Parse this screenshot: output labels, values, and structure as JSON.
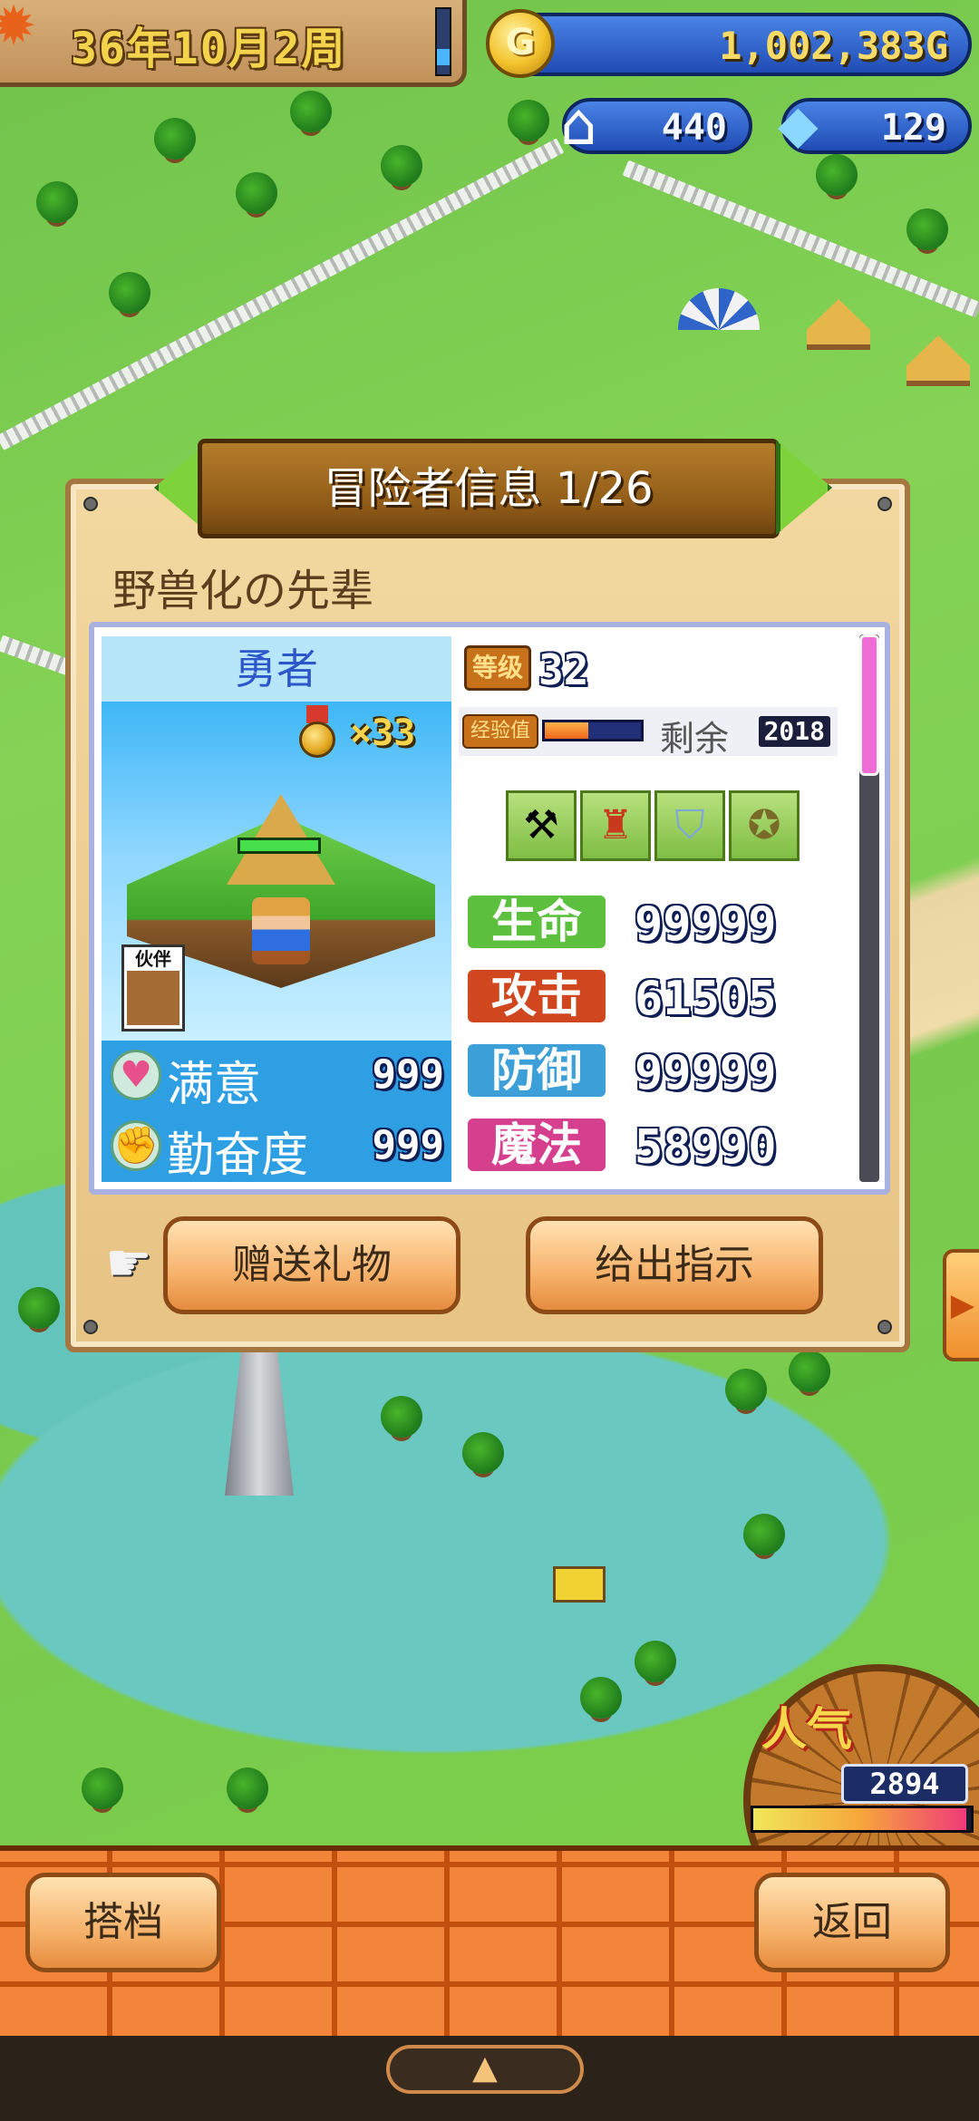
{
  "hud": {
    "date": "36年10月2周",
    "gold": "1,002,383G",
    "houses": "440",
    "gems": "129"
  },
  "dialog": {
    "title": "冒险者信息 1/26",
    "adventurer_name": "野兽化の先辈",
    "class_name": "勇者",
    "medal_count": "×33",
    "partner_tag": "伙伴",
    "level_tag": "等级",
    "level": "32",
    "exp_tag": "经验值",
    "exp_progress": 0.45,
    "remaining_label": "剩余",
    "remaining_value": "2018",
    "satisfaction": {
      "label": "满意",
      "value": "999"
    },
    "diligence": {
      "label": "勤奋度",
      "value": "999"
    },
    "equipment": [
      "axe-icon",
      "armor-icon",
      "shield-icon",
      "accessory-icon"
    ],
    "stats": [
      {
        "label": "生命",
        "value": "99999",
        "color": "#5cbf3d"
      },
      {
        "label": "攻击",
        "value": "61505",
        "color": "#d0471f"
      },
      {
        "label": "防御",
        "value": "99999",
        "color": "#3d9fd8"
      },
      {
        "label": "魔法",
        "value": "58990",
        "color": "#d63f8e"
      }
    ],
    "gift_button": "赠送礼物",
    "instruct_button": "给出指示"
  },
  "popularity": {
    "label": "人气",
    "value": "2894",
    "level": 0.98
  },
  "bottom": {
    "partner_button": "搭档",
    "back_button": "返回",
    "handle_glyph": "▲"
  },
  "colors": {
    "hud_blue": "#1f4cb4",
    "panel": "#e7c384",
    "button": "#f6b26b",
    "brick": "#f3853a"
  }
}
